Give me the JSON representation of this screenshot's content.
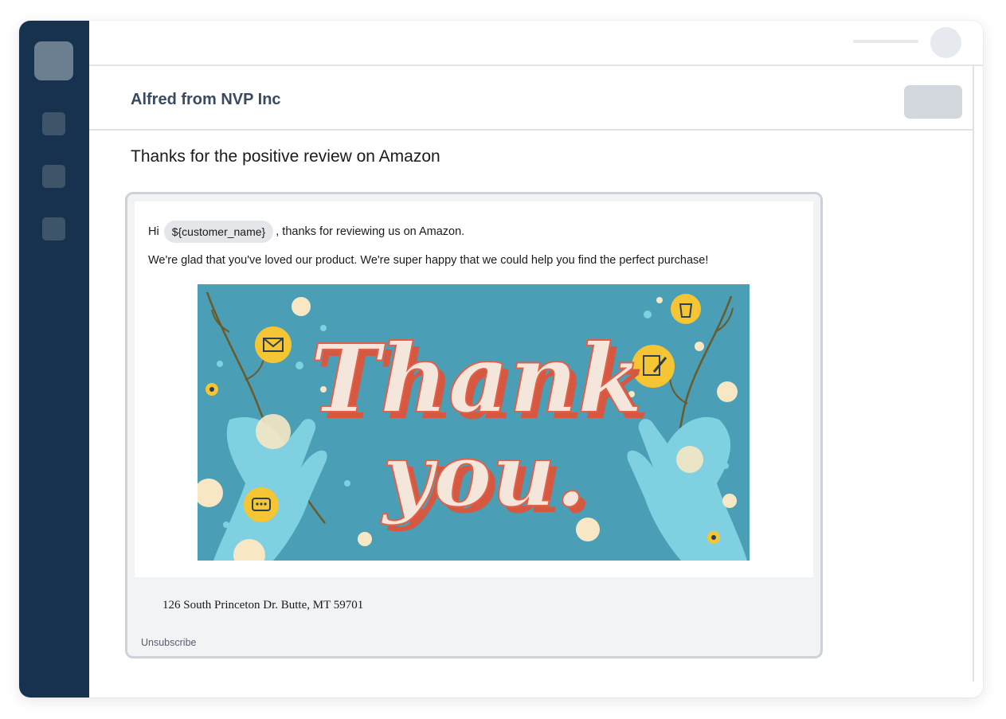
{
  "header": {
    "sender": "Alfred from NVP Inc"
  },
  "email": {
    "subject": "Thanks for the positive review on Amazon",
    "greeting_prefix": "Hi",
    "variable_chip": "${customer_name}",
    "greeting_suffix": ", thanks for reviewing us on Amazon.",
    "body_line": "We're glad that you've loved our product. We're super happy that we could help you find the perfect purchase!",
    "image": {
      "line1": "Thank",
      "line2": "you.",
      "colors": {
        "background": "#4a9eb6",
        "lettering": "#f5e6dc",
        "shadow": "#e0614a",
        "hands": "#7fd0e0",
        "icons": "#f5c533"
      }
    },
    "address": "126 South Princeton Dr. Butte, MT 59701",
    "unsubscribe": "Unsubscribe"
  },
  "colors": {
    "sidebar": "#16324e",
    "accent": "#3a4a5f"
  }
}
